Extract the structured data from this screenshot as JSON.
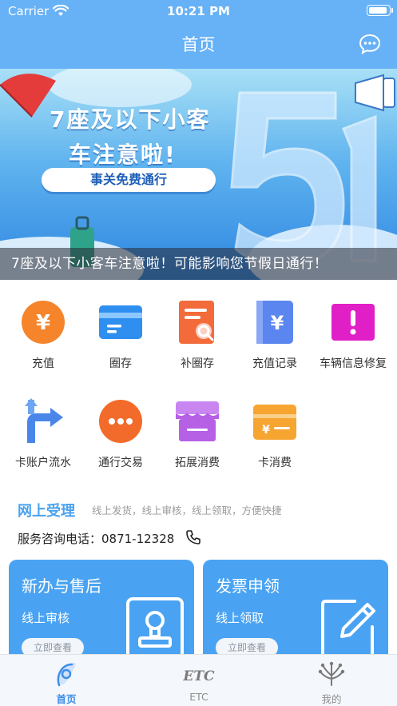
{
  "status_bar": {
    "carrier": "Carrier",
    "time": "10:21 PM"
  },
  "nav": {
    "title": "首页",
    "message_icon": "chat-bubble-icon"
  },
  "banner": {
    "headline_line1": "7座及以下小客",
    "headline_line2": "车注意啦!",
    "pill": "事关免费通行",
    "big_number": "51",
    "caption": "7座及以下小客车注意啦！可能影响您节假日通行！"
  },
  "services": [
    {
      "label": "充值",
      "icon": "yuan-coin-icon",
      "color": "#f5842b"
    },
    {
      "label": "圈存",
      "icon": "card-icon",
      "color": "#2f8ff0"
    },
    {
      "label": "补圈存",
      "icon": "document-search-icon",
      "color": "#f36b3a"
    },
    {
      "label": "充值记录",
      "icon": "yuan-book-icon",
      "color": "#5b86f0"
    },
    {
      "label": "车辆信息修复",
      "icon": "alert-icon",
      "color": "#e01fc6"
    },
    {
      "label": "卡账户流水",
      "icon": "turn-arrow-icon",
      "color": "#4a86ea"
    },
    {
      "label": "通行交易",
      "icon": "dots-icon",
      "color": "#f36b2a"
    },
    {
      "label": "拓展消费",
      "icon": "shop-icon",
      "color": "#b660e6"
    },
    {
      "label": "卡消费",
      "icon": "yuan-card-icon",
      "color": "#f7a531"
    }
  ],
  "online": {
    "title": "网上受理",
    "subtitle": "线上发货，线上审核，线上领取，方便快捷",
    "hotline": "服务咨询电话：0871-12328"
  },
  "cards": [
    {
      "title": "新办与售后",
      "subtitle": "线上审核",
      "button": "立即查看",
      "icon": "id-badge-icon"
    },
    {
      "title": "发票申领",
      "subtitle": "线上领取",
      "button": "立即查看",
      "icon": "edit-icon"
    }
  ],
  "tabs": [
    {
      "label": "首页",
      "icon": "home-icon",
      "active": true
    },
    {
      "label": "ETC",
      "icon": "etc-icon",
      "active": false
    },
    {
      "label": "我的",
      "icon": "profile-icon",
      "active": false
    }
  ],
  "colors": {
    "primary": "#67b1f6",
    "accent": "#4aa3f2",
    "tab_active": "#3d8ee8"
  }
}
